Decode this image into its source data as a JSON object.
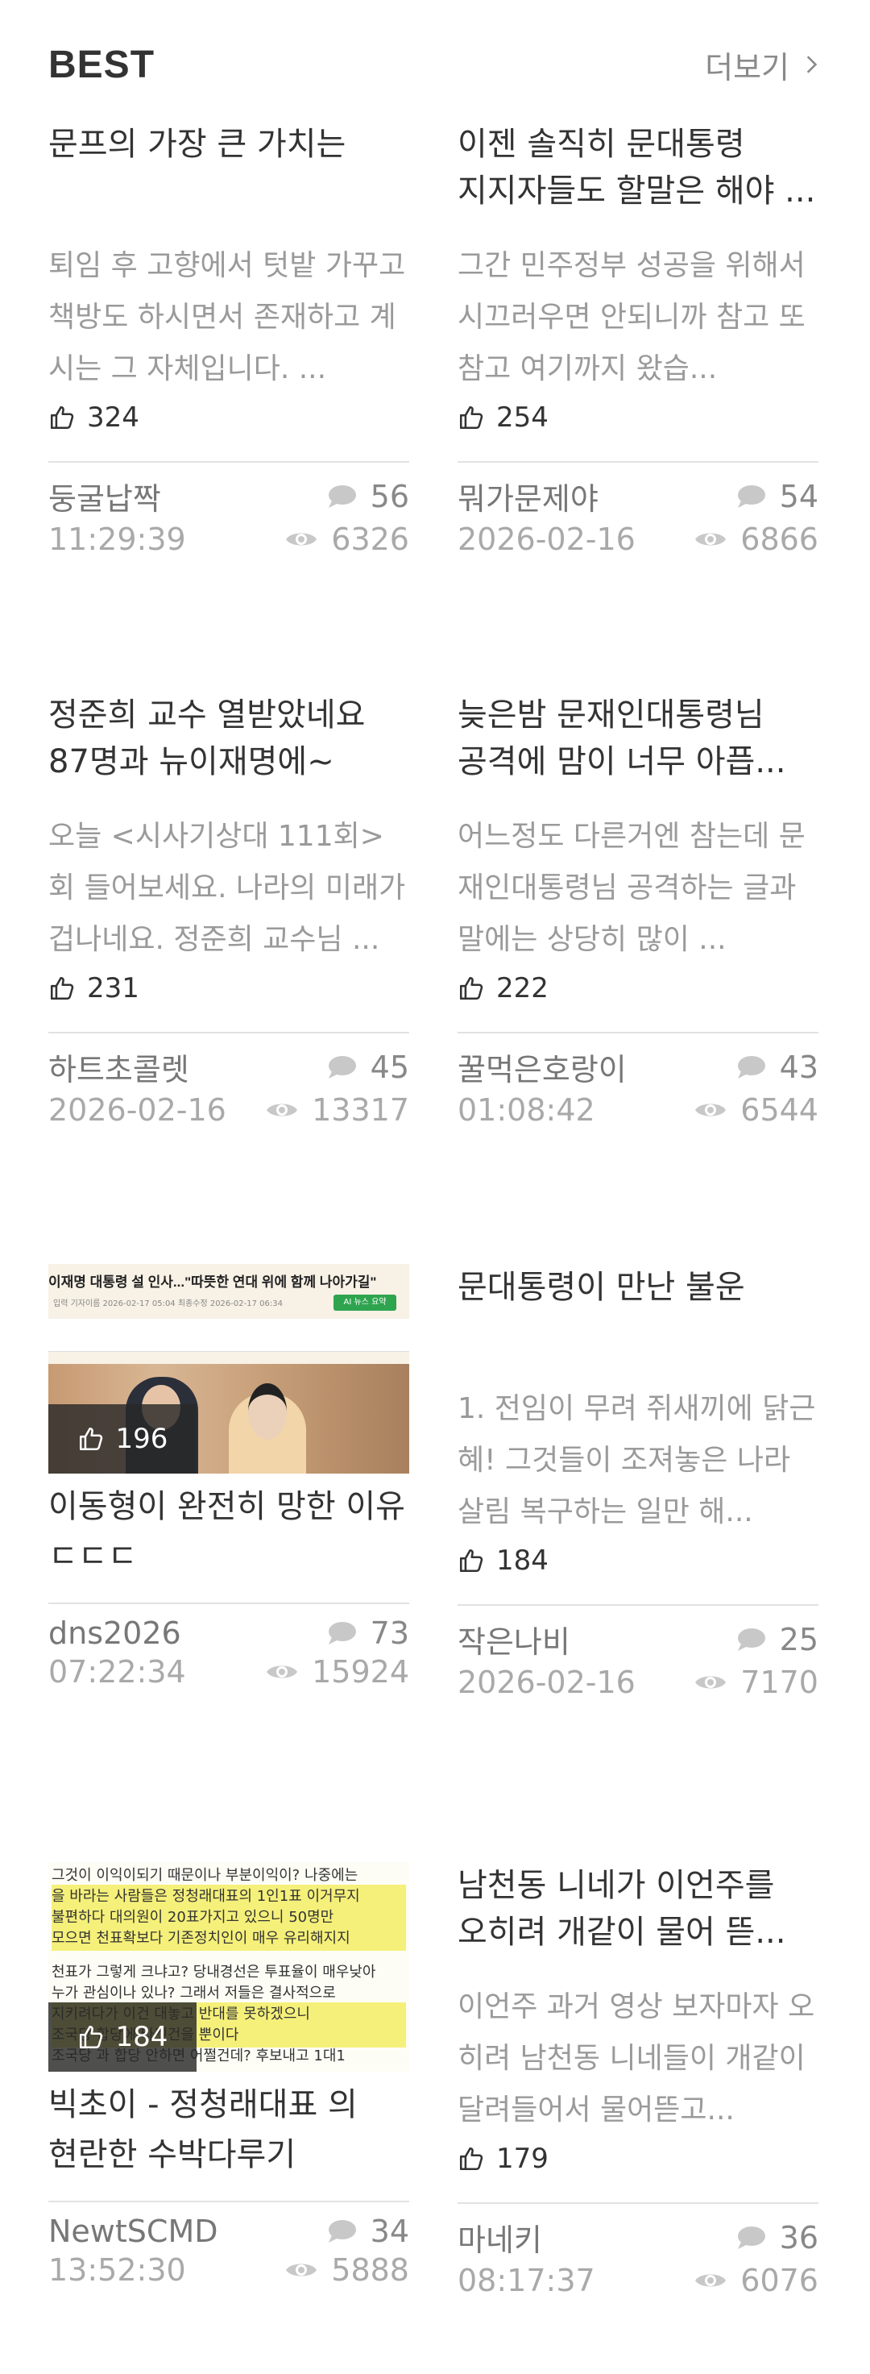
{
  "header": {
    "title": "BEST",
    "more_label": "더보기"
  },
  "icons": {
    "like": "thumbs-up-icon",
    "comment": "comment-bubble-icon",
    "view": "eye-icon",
    "more": "chevron-right-icon"
  },
  "colors": {
    "text": "#333333",
    "muted": "#9a9a9a",
    "divider": "#e2e2e2",
    "overlay": "#282828"
  },
  "posts": [
    {
      "title": "문프의 가장 큰 가치는",
      "excerpt": "퇴임 후 고향에서 텃밭 가꾸고 책방도 하시면서  존재하고 계시는 그 자체입니다. ...",
      "likes": "324",
      "author": "둥굴납짝",
      "time": "11:29:39",
      "comments": "56",
      "views": "6326"
    },
    {
      "title": "이젠 솔직히 문대통령 지지자들도 할말은 해야 ...",
      "excerpt": "그간 민주정부 성공을 위해서 시끄러우면 안되니까 참고 또 참고 여기까지 왔습...",
      "likes": "254",
      "author": "뭐가문제야",
      "time": "2026-02-16",
      "comments": "54",
      "views": "6866"
    },
    {
      "title": "정준희 교수 열받았네요 87명과 뉴이재명에~",
      "excerpt": "오늘 <시사기상대 111회>회 들어보세요.  나라의 미래가 겁나네요.  정준희 교수님 ...",
      "likes": "231",
      "author": "하트초콜렛",
      "time": "2026-02-16",
      "comments": "45",
      "views": "13317"
    },
    {
      "title": "늦은밤 문재인대통령님 공격에 맘이 너무 아픕...",
      "excerpt": "어느정도 다른거엔 참는데 문재인대통령님 공격하는 글과 말에는 상당히 많이 ...",
      "likes": "222",
      "author": "꿀먹은호랑이",
      "time": "01:08:42",
      "comments": "43",
      "views": "6544"
    },
    {
      "title": "이동형이 완전히 망한 이유 ㄷㄷㄷ",
      "likes": "196",
      "author": "dns2026",
      "time": "07:22:34",
      "comments": "73",
      "views": "15924",
      "image": {
        "caption": "이재명 대통령 설 인사...\"따뜻한 연대 위에 함께 나아가길\"",
        "sub": "입력 기자이름 2026-02-17 05:04  최종수정 2026-02-17 06:34",
        "badge": "AI 뉴스 요약"
      }
    },
    {
      "title": "문대통령이 만난 불운",
      "excerpt": "1. 전임이 무려 쥐새끼에 닭근혜! 그것들이 조져놓은 나라 살림 복구하는 일만 해...",
      "likes": "184",
      "author": "작은나비",
      "time": "2026-02-16",
      "comments": "25",
      "views": "7170"
    },
    {
      "title": "빅초이 - 정청래대표 의 현란한 수박다루기",
      "likes": "184",
      "author": "NewtSCMD",
      "time": "13:52:30",
      "comments": "34",
      "views": "5888",
      "image": {
        "lines": [
          "그것이 이익이되기 때문이나 부분이익이? 나중에는",
          "을 바라는 사람들은 정청래대표의 1인1표 이거무지",
          "불편하다 대의원이 20표가지고 있으니 50명만",
          "모으면 천표확보다 기존정치인이 매우 유리해지지",
          "",
          "천표가 그렇게 크냐고? 당내경선은 투표율이 매우낮아",
          "누가 관심이나 있나? 그래서 저들은 결사적으로",
          "지키려다가 이건 대놓고 반대를 못하겠으니",
          "조국당 합당에 타겟건을 뿐이다",
          "조국당 과 합당 안하면 어쩔건데? 후보내고 1대1"
        ]
      }
    },
    {
      "title": "남천동 니네가 이언주를 오히려 개같이 물어 뜯...",
      "excerpt": "이언주 과거 영상 보자마자 오히려 남천동 니네들이 개같이 달려들어서 물어뜯고...",
      "likes": "179",
      "author": "마네키",
      "time": "08:17:37",
      "comments": "36",
      "views": "6076"
    }
  ]
}
